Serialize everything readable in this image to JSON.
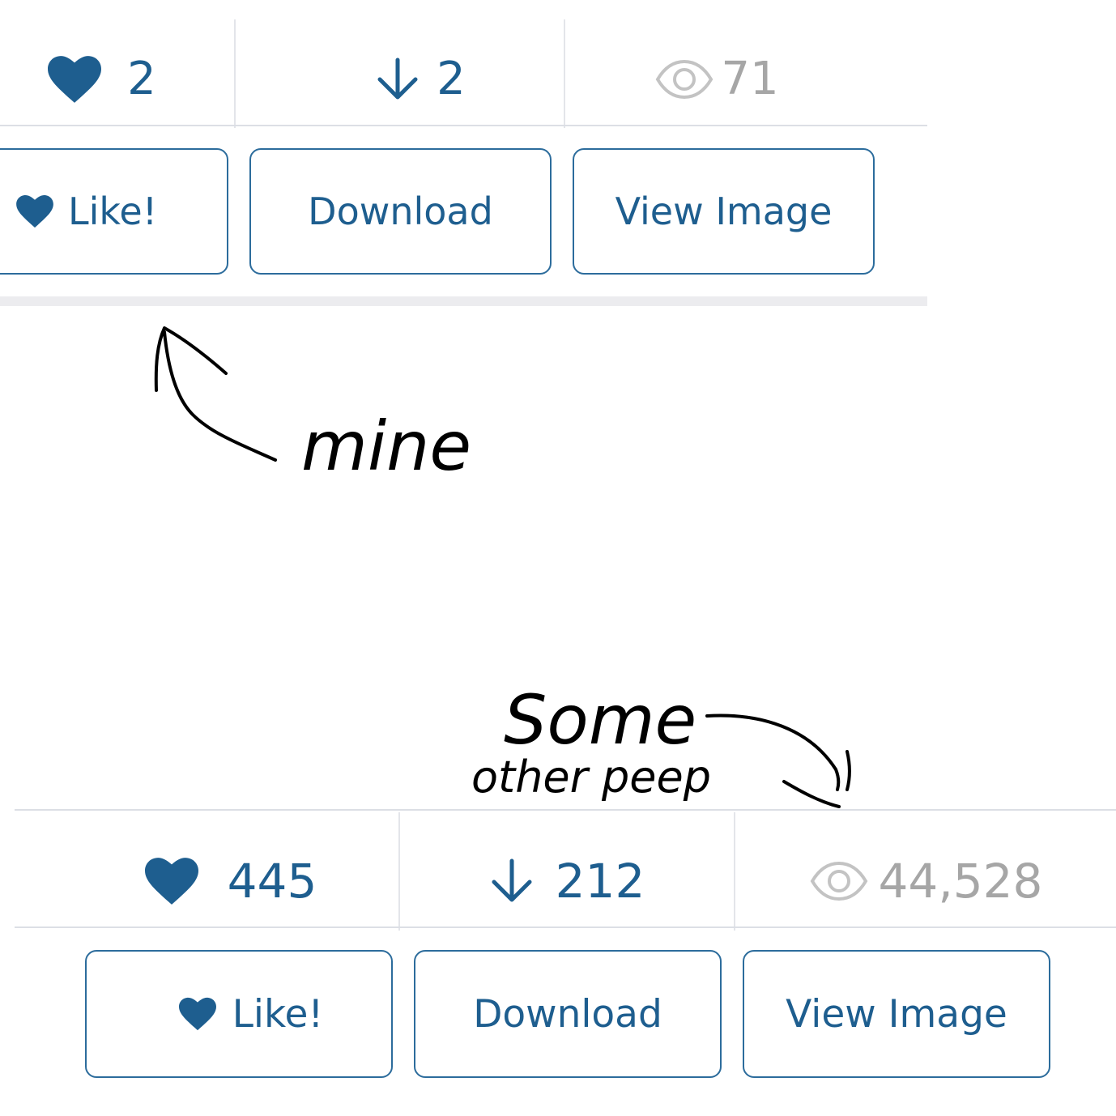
{
  "colors": {
    "accent": "#1e5e8f",
    "button_border": "#2c6c9c",
    "muted": "#a6a6a6",
    "divider": "#dcdfe5",
    "ink": "#000000"
  },
  "card_mine": {
    "stats": {
      "likes": "2",
      "downloads": "2",
      "views": "71"
    },
    "buttons": {
      "like": "Like!",
      "download": "Download",
      "view": "View Image"
    }
  },
  "card_other": {
    "stats": {
      "likes": "445",
      "downloads": "212",
      "views": "44,528"
    },
    "buttons": {
      "like": "Like!",
      "download": "Download",
      "view": "View Image"
    }
  },
  "annotations": {
    "mine": "mine",
    "other_line1": "Some",
    "other_line2": "other peep"
  },
  "icons": {
    "like": "heart-icon",
    "download": "arrow-down-icon",
    "views": "eye-icon"
  }
}
